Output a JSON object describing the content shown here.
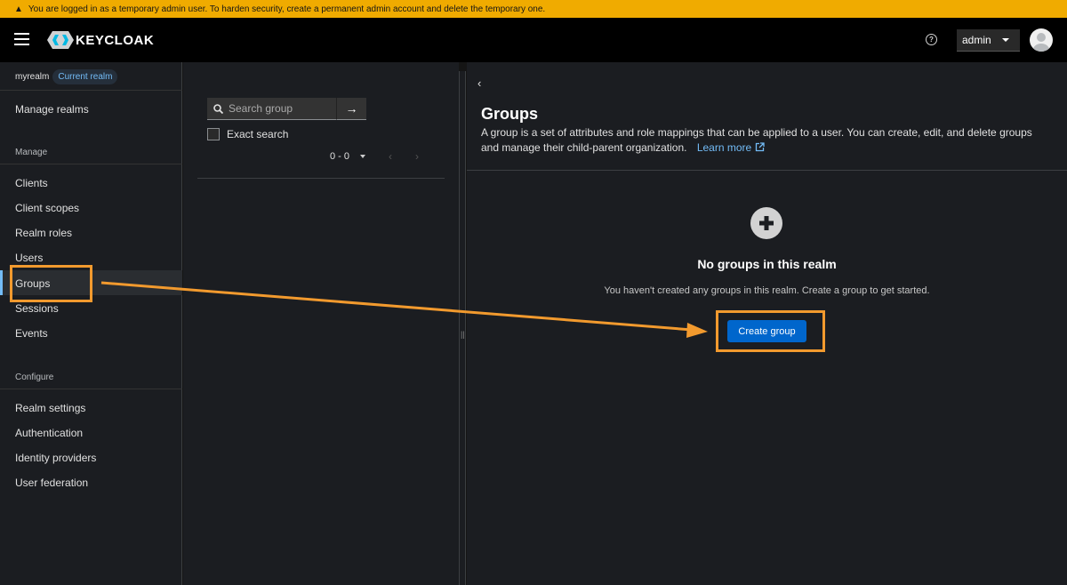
{
  "banner": {
    "icon": "warning-triangle-icon",
    "text": "You are logged in as a temporary admin user. To harden security, create a permanent admin account and delete the temporary one.",
    "color": "#f0ab00"
  },
  "header": {
    "logo_text": "KEYCLOAK",
    "user": "admin"
  },
  "sidebar": {
    "realm": "myrealm",
    "realm_badge": "Current realm",
    "manage_realms": "Manage realms",
    "section_manage": "Manage",
    "manage_items": [
      {
        "label": "Clients"
      },
      {
        "label": "Client scopes"
      },
      {
        "label": "Realm roles"
      },
      {
        "label": "Users"
      },
      {
        "label": "Groups"
      },
      {
        "label": "Sessions"
      },
      {
        "label": "Events"
      }
    ],
    "section_configure": "Configure",
    "configure_items": [
      {
        "label": "Realm settings"
      },
      {
        "label": "Authentication"
      },
      {
        "label": "Identity providers"
      },
      {
        "label": "User federation"
      }
    ],
    "active_item": "Groups"
  },
  "tree_panel": {
    "search_placeholder": "Search group",
    "exact_search_label": "Exact search",
    "pagination": "0 - 0"
  },
  "main": {
    "title": "Groups",
    "description": "A group is a set of attributes and role mappings that can be applied to a user. You can create, edit, and delete groups and manage their child-parent organization.",
    "learn_more": "Learn more",
    "empty_title": "No groups in this realm",
    "empty_body": "You haven't created any groups in this realm. Create a group to get started.",
    "create_button": "Create group"
  },
  "annotation_color": "#f29a2e",
  "accent_color": "#0066cc"
}
